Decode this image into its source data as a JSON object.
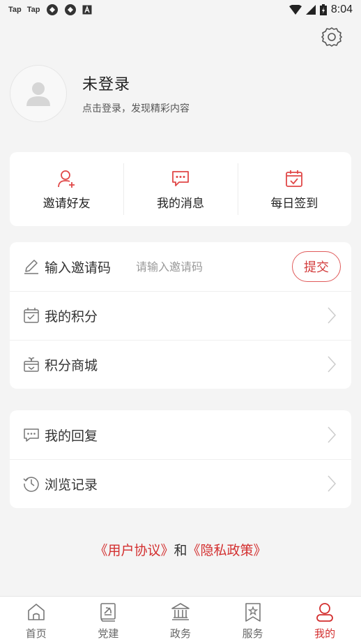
{
  "status_bar": {
    "left_labels": [
      "Tap",
      "Tap"
    ],
    "time": "8:04"
  },
  "profile": {
    "title": "未登录",
    "subtitle": "点击登录，发现精彩内容"
  },
  "quick_actions": [
    {
      "label": "邀请好友",
      "icon": "user-add-icon"
    },
    {
      "label": "我的消息",
      "icon": "message-icon"
    },
    {
      "label": "每日签到",
      "icon": "calendar-check-icon"
    }
  ],
  "invite": {
    "label": "输入邀请码",
    "placeholder": "请输入邀请码",
    "submit_label": "提交"
  },
  "menu_group_1": [
    {
      "label": "我的积分",
      "icon": "points-calendar-icon"
    },
    {
      "label": "积分商城",
      "icon": "gift-box-icon"
    }
  ],
  "menu_group_2": [
    {
      "label": "我的回复",
      "icon": "reply-bubble-icon"
    },
    {
      "label": "浏览记录",
      "icon": "history-clock-icon"
    }
  ],
  "agreement": {
    "user_agreement": "《用户协议》",
    "and": "和",
    "privacy_policy": "《隐私政策》"
  },
  "tabbar": [
    {
      "label": "首页",
      "icon": "home-icon"
    },
    {
      "label": "党建",
      "icon": "party-building-icon"
    },
    {
      "label": "政务",
      "icon": "government-building-icon"
    },
    {
      "label": "服务",
      "icon": "service-bookmark-icon"
    },
    {
      "label": "我的",
      "icon": "profile-icon",
      "active": true
    }
  ],
  "colors": {
    "accent": "#d32f2f",
    "background": "#f4f4f4",
    "card": "#ffffff"
  }
}
